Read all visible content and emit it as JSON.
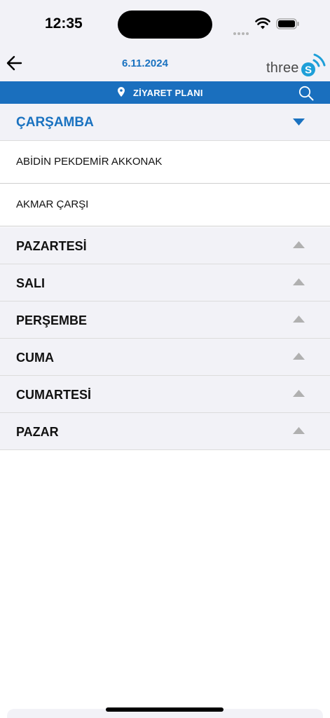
{
  "status": {
    "time": "12:35"
  },
  "header": {
    "date": "6.11.2024",
    "logo_text": "three",
    "logo_letter": "S"
  },
  "bar": {
    "title": "ZİYARET PLANI"
  },
  "expanded_day": {
    "label": "ÇARŞAMBA",
    "visits": [
      {
        "label": "ABİDİN PEKDEMİR AKKONAK"
      },
      {
        "label": "AKMAR ÇARŞI"
      }
    ]
  },
  "collapsed_days": [
    {
      "label": "PAZARTESİ"
    },
    {
      "label": "SALI"
    },
    {
      "label": "PERŞEMBE"
    },
    {
      "label": "CUMA"
    },
    {
      "label": "CUMARTESİ"
    },
    {
      "label": "PAZAR"
    }
  ],
  "colors": {
    "accent": "#1a72c0",
    "bar": "#1a6fbe",
    "section_bg": "#f2f2f7",
    "arrow_gray": "#b0b0b0"
  },
  "icons": {
    "back": "arrow-left-icon",
    "pin": "location-pin-icon",
    "search": "search-icon",
    "expanded_arrow": "triangle-down-icon",
    "collapsed_arrow": "triangle-up-icon"
  }
}
